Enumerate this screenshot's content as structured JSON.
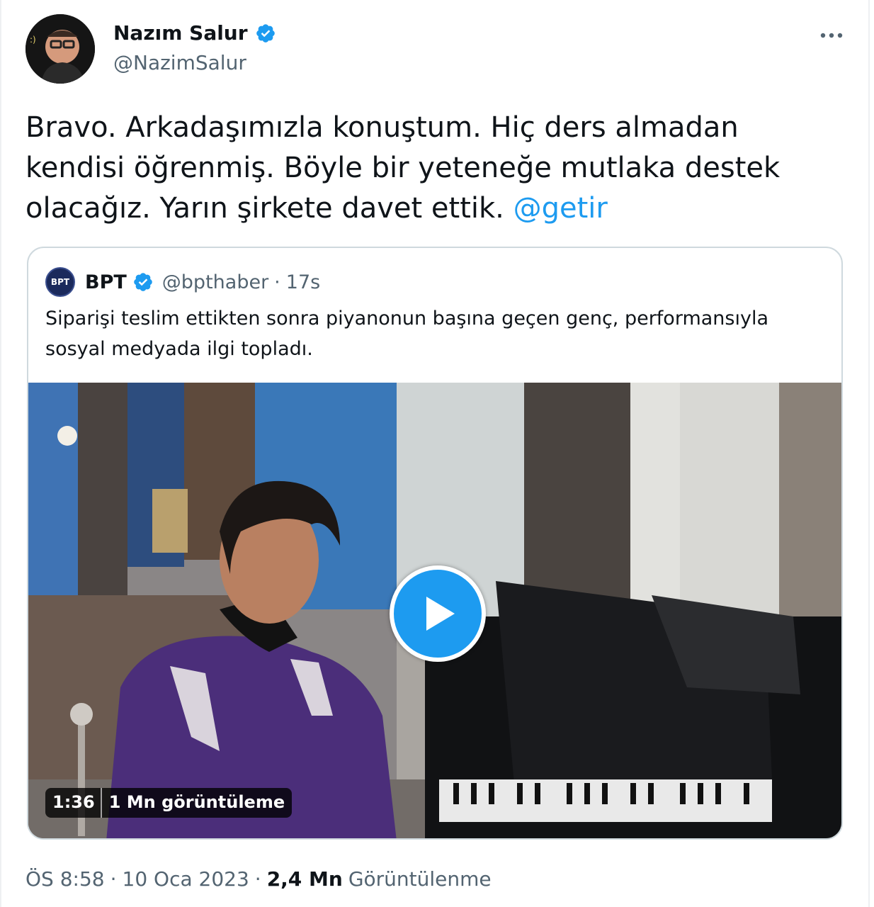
{
  "tweet": {
    "author_name": "Nazım Salur",
    "author_handle": "@NazimSalur",
    "text_before_mention": "Bravo. Arkadaşımızla konuştum. Hiç ders almadan kendisi öğrenmiş. Böyle bir yeteneğe mutlaka destek olacağız. Yarın şirkete davet ettik. ",
    "mention": "@getir",
    "more_icon": "more-horizontal-icon",
    "verified_icon": "verified-badge-icon"
  },
  "quote": {
    "avatar_text": "BPT",
    "name": "BPT",
    "handle": "@bpthaber",
    "separator": "·",
    "time": "17s",
    "text": "Siparişi teslim ettikten sonra piyanonun başına geçen genç, performansıyla sosyal medyada ilgi topladı."
  },
  "video": {
    "duration": "1:36",
    "views": "1 Mn görüntüleme",
    "play_icon": "play-icon"
  },
  "footer": {
    "time": "ÖS 8:58",
    "sep1": "·",
    "date": "10 Oca 2023",
    "sep2": "·",
    "view_count": "2,4 Mn",
    "view_label": "Görüntülenme"
  },
  "colors": {
    "accent": "#1d9bf0",
    "text": "#0f1419",
    "secondary": "#536471",
    "border": "#cfd9de"
  }
}
